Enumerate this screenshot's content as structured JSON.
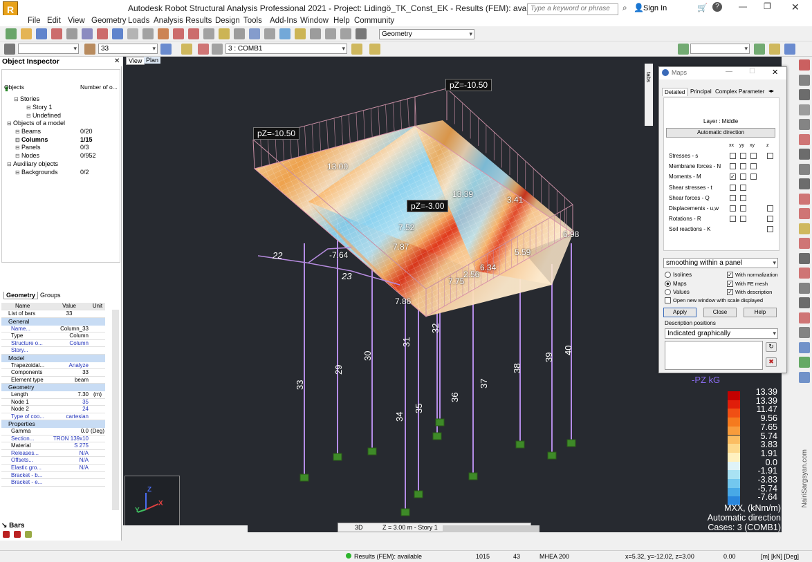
{
  "window": {
    "title": "Autodesk Robot Structural Analysis Professional 2021 - Project: Lidingö_TK_Const_EK - Results (FEM): available",
    "search_placeholder": "Type a keyword or phrase",
    "sign_in": "Sign In"
  },
  "menu": [
    "File",
    "Edit",
    "View",
    "Geometry",
    "Loads",
    "Analysis",
    "Results",
    "Design",
    "Tools",
    "Add-Ins",
    "Window",
    "Help",
    "Community"
  ],
  "toolbar": {
    "layout_select": "Geometry",
    "bar_select": "33",
    "case_select": "3 : COMB1"
  },
  "inspector": {
    "title": "Object Inspector",
    "col_objects": "Objects",
    "col_number": "Number of o...",
    "tree": [
      {
        "label": "Stories",
        "num": ""
      },
      {
        "label": "Story 1",
        "num": ""
      },
      {
        "label": "Undefined",
        "num": ""
      },
      {
        "label": "Objects of a model",
        "num": ""
      },
      {
        "label": "Beams",
        "num": "0/20"
      },
      {
        "label": "Columns",
        "num": "1/15"
      },
      {
        "label": "Panels",
        "num": "0/3"
      },
      {
        "label": "Nodes",
        "num": "0/952"
      },
      {
        "label": "Auxiliary objects",
        "num": ""
      },
      {
        "label": "Backgrounds",
        "num": "0/2"
      }
    ],
    "tabs": [
      "Geometry",
      "Groups"
    ],
    "grid_headers": [
      "Name",
      "Value",
      "Unit"
    ],
    "list_of_bars": {
      "name": "List of bars",
      "value": "33"
    },
    "sections": [
      {
        "title": "General",
        "rows": [
          {
            "n": "Name...",
            "v": "Column_33",
            "u": ""
          },
          {
            "n": "Type",
            "v": "Column",
            "u": ""
          },
          {
            "n": "Structure o...",
            "v": "Column",
            "u": ""
          },
          {
            "n": "Story...",
            "v": "",
            "u": ""
          }
        ]
      },
      {
        "title": "Model",
        "rows": [
          {
            "n": "Trapezoidal...",
            "v": "Analyze",
            "u": ""
          },
          {
            "n": "Components",
            "v": "33",
            "u": ""
          },
          {
            "n": "Element type",
            "v": "beam",
            "u": ""
          }
        ]
      },
      {
        "title": "Geometry",
        "rows": [
          {
            "n": "Length",
            "v": "7.30",
            "u": "(m)"
          },
          {
            "n": "Node 1",
            "v": "35",
            "u": ""
          },
          {
            "n": "Node 2",
            "v": "24",
            "u": ""
          },
          {
            "n": "Type of coo...",
            "v": "cartesian",
            "u": ""
          }
        ]
      },
      {
        "title": "Properties",
        "rows": [
          {
            "n": "Gamma",
            "v": "0.0",
            "u": "(Deg)"
          },
          {
            "n": "Section...",
            "v": "TRON 139x10",
            "u": ""
          },
          {
            "n": "Material",
            "v": "S 275",
            "u": ""
          },
          {
            "n": "Releases...",
            "v": "N/A",
            "u": ""
          },
          {
            "n": "Offsets...",
            "v": "N/A",
            "u": ""
          },
          {
            "n": "Elastic gro...",
            "v": "N/A",
            "u": ""
          },
          {
            "n": "Bracket - b...",
            "v": "",
            "u": ""
          },
          {
            "n": "Bracket - e...",
            "v": "",
            "u": ""
          }
        ]
      }
    ],
    "bottom_tab": "Bars"
  },
  "view": {
    "tabs": [
      "View",
      "Plan"
    ],
    "mode": "3D",
    "level": "Z = 3.00 m - Story 1",
    "tabs_label": "tabs",
    "loads": [
      "pZ=-10.50",
      "pZ=-10.50",
      "pZ=-3.00"
    ],
    "plate_values": [
      "13.39",
      "13.00",
      "7.52",
      "7.87",
      "-7.64",
      "7.86",
      "7.75",
      "2.56",
      "6.34",
      "6.98",
      "5.59",
      "3.41"
    ],
    "column_labels": [
      "33",
      "29",
      "30",
      "31",
      "32",
      "34",
      "35",
      "36",
      "37",
      "38",
      "39",
      "40"
    ],
    "beam_labels": [
      "22",
      "23"
    ],
    "pz_legend": "-PZ  kG",
    "legend_values": [
      "13.39",
      "13.39",
      "11.47",
      "9.56",
      "7.65",
      "5.74",
      "3.83",
      "1.91",
      "0.0",
      "-1.91",
      "-3.83",
      "-5.74",
      "-7.64"
    ],
    "legend_colors": [
      "#c40000",
      "#e01e0a",
      "#f04f14",
      "#f57a1e",
      "#f89c3c",
      "#fbbd62",
      "#fdd98c",
      "#fff1bf",
      "#dff3f8",
      "#a9e2f3",
      "#73c7ee",
      "#48a9e6",
      "#2a86dc"
    ],
    "legend_title": "MXX, (kNm/m)",
    "legend_dir": "Automatic direction",
    "legend_cases": "Cases: 3 (COMB1)",
    "watermark": "NairiSargsyan.com"
  },
  "maps": {
    "title": "Maps",
    "tabs": [
      "Detailed",
      "Principal",
      "Complex",
      "Parameter"
    ],
    "layer": "Layer : Middle",
    "auto_dir": "Automatic direction",
    "cols": [
      "xx",
      "yy",
      "xy",
      "z"
    ],
    "rows": [
      {
        "label": "Stresses - s",
        "checked": [
          false,
          false,
          false,
          false
        ]
      },
      {
        "label": "Membrane forces - N",
        "checked": [
          false,
          false,
          false
        ]
      },
      {
        "label": "Moments - M",
        "checked": [
          true,
          false,
          false
        ]
      },
      {
        "label": "Shear stresses - t",
        "checked": [
          false,
          false
        ]
      },
      {
        "label": "Shear forces - Q",
        "checked": [
          false,
          false
        ]
      },
      {
        "label": "Displacements - u,w",
        "checked": [
          false,
          false,
          false
        ]
      },
      {
        "label": "Rotations - R",
        "checked": [
          false,
          false,
          false
        ]
      },
      {
        "label": "Soil reactions - K",
        "checked": [
          false
        ]
      }
    ],
    "smoothing": "smoothing within a panel",
    "radios": [
      {
        "label": "Isolines",
        "on": false
      },
      {
        "label": "Maps",
        "on": true
      },
      {
        "label": "Values",
        "on": false
      }
    ],
    "checks": [
      {
        "label": "With normalization",
        "on": true
      },
      {
        "label": "With FE mesh",
        "on": true
      },
      {
        "label": "With description",
        "on": true
      }
    ],
    "new_window": "Open new window with scale displayed",
    "buttons": [
      "Apply",
      "Close",
      "Help"
    ],
    "desc_positions": "Description positions",
    "desc_select": "Indicated graphically"
  },
  "status": {
    "view": "View",
    "results": "Results (FEM): available",
    "n1": "1015",
    "n2": "43",
    "section": "MHEA 200",
    "coords": "x=5.32, y=-12.02, z=3.00",
    "angle": "0.00",
    "units": "[m] [kN] [Deg]"
  }
}
